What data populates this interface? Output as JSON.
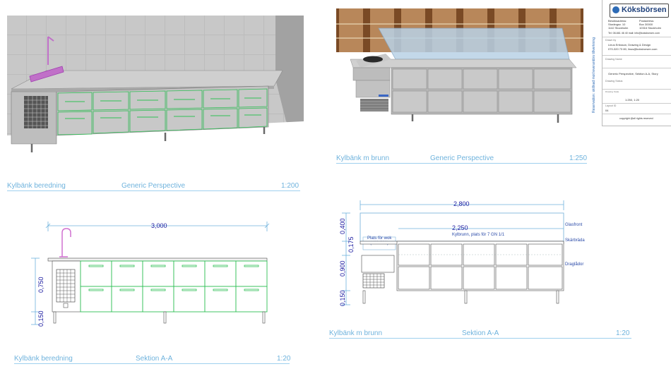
{
  "sheet": {
    "views": [
      {
        "caption_left": "Kylbänk beredning",
        "caption_mid": "Generic Perspective",
        "caption_scale": "1:200"
      },
      {
        "caption_left": "Kylbänk m brunn",
        "caption_mid": "Generic Perspective",
        "caption_scale": "1:250"
      },
      {
        "caption_left": "Kylbänk beredning",
        "caption_mid": "Sektion A-A",
        "caption_scale": "1:20"
      },
      {
        "caption_left": "Kylbänk m brunn",
        "caption_mid": "Sektion A-A",
        "caption_scale": "1:20"
      }
    ],
    "dims_left": {
      "width": "3,000",
      "height1": "0,750",
      "height2": "0,150"
    },
    "dims_right": {
      "width": "2,800",
      "inner": "2,250",
      "h1": "0,400",
      "h2": "0,175",
      "h3": "0,900",
      "h4": "0,150"
    },
    "labels_right": {
      "well": "Kylbrunn, plats för 7 GN 1/1",
      "wok1": "Plats för wok",
      "wok2": "(400-500)",
      "glass": "Glasfront",
      "board": "Skärbräda",
      "drawers": "Draglådor"
    }
  },
  "title_block": {
    "logo": "Köksbörsen",
    "col1": [
      "Besöksadress:",
      "Storängsv. 10",
      "1142 Stockholm"
    ],
    "col2": [
      "Postadress:",
      "Box 30000",
      "10316 Stockholm"
    ],
    "tel": "Tel: 08-661 46 40   mail: info@koksborsen.com",
    "drawn_by_label": "Drawn by",
    "drawn_by": "Linus Eriksson, Drawing & Design",
    "drawn_by_contact": "070-320 73 80, linus@koksborsen.com",
    "drawing_name_label": "Drawing Name",
    "drawing_name": "Generic Perspective, Sektion A-A, Story",
    "status_label": "Drawing Status",
    "scale_label": "Drawing Scale",
    "scale": "1:250, 1:20",
    "layout_label": "Layout ID",
    "layout_id": "04",
    "copyright": "copyright @all rights reserved",
    "side_note": "Reservation: skillnad mot leverantörs tillverkning"
  }
}
